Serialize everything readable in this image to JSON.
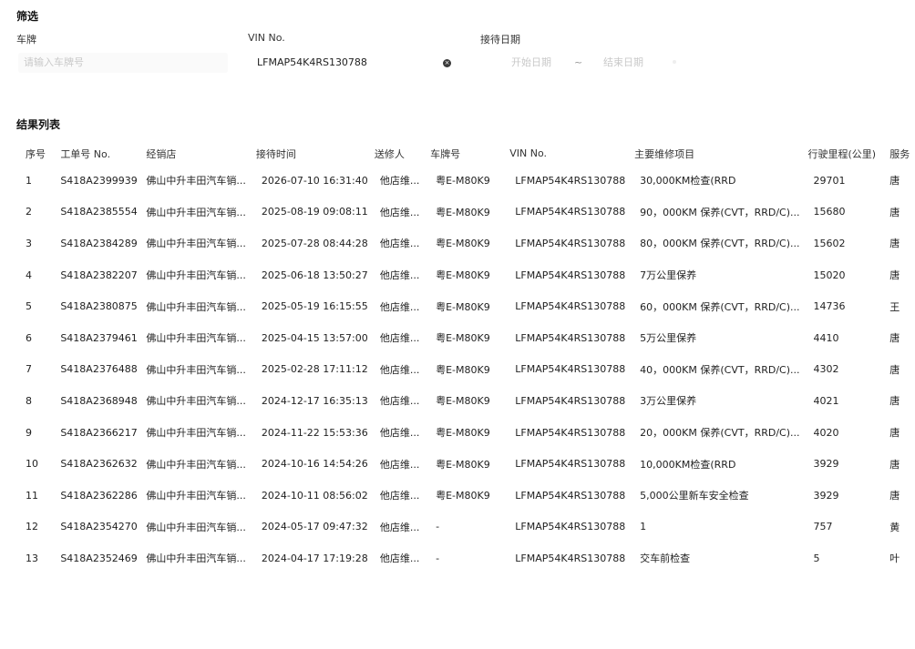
{
  "filter": {
    "title": "筛选",
    "plate_label": "车牌",
    "plate_placeholder": "请输入车牌号",
    "vin_label": "VIN No.",
    "vin_value": "LFMAP54K4RS130788",
    "date_label": "接待日期",
    "date_start_placeholder": "开始日期",
    "date_sep": "~",
    "date_end_placeholder": "结束日期"
  },
  "results": {
    "title": "结果列表",
    "columns": [
      "序号",
      "工单号 No.",
      "经销店",
      "接待时间",
      "送修人",
      "车牌号",
      "VIN No.",
      "主要维修项目",
      "行驶里程(公里)",
      "服务"
    ],
    "rows": [
      [
        "1",
        "S418A2399939",
        "佛山中升丰田汽车销...",
        "2026-07-10 16:31:40",
        "他店维...",
        "粤E-M80K9",
        "LFMAP54K4RS130788",
        "30,000KM检查(RRD",
        "29701",
        "唐"
      ],
      [
        "2",
        "S418A2385554",
        "佛山中升丰田汽车销...",
        "2025-08-19 09:08:11",
        "他店维...",
        "粤E-M80K9",
        "LFMAP54K4RS130788",
        "90，000KM 保养(CVT，RRD/C)...",
        "15680",
        "唐"
      ],
      [
        "3",
        "S418A2384289",
        "佛山中升丰田汽车销...",
        "2025-07-28 08:44:28",
        "他店维...",
        "粤E-M80K9",
        "LFMAP54K4RS130788",
        "80，000KM 保养(CVT，RRD/C)...",
        "15602",
        "唐"
      ],
      [
        "4",
        "S418A2382207",
        "佛山中升丰田汽车销...",
        "2025-06-18 13:50:27",
        "他店维...",
        "粤E-M80K9",
        "LFMAP54K4RS130788",
        "7万公里保养",
        "15020",
        "唐"
      ],
      [
        "5",
        "S418A2380875",
        "佛山中升丰田汽车销...",
        "2025-05-19 16:15:55",
        "他店维...",
        "粤E-M80K9",
        "LFMAP54K4RS130788",
        "60，000KM 保养(CVT，RRD/C)...",
        "14736",
        "王"
      ],
      [
        "6",
        "S418A2379461",
        "佛山中升丰田汽车销...",
        "2025-04-15 13:57:00",
        "他店维...",
        "粤E-M80K9",
        "LFMAP54K4RS130788",
        "5万公里保养",
        "4410",
        "唐"
      ],
      [
        "7",
        "S418A2376488",
        "佛山中升丰田汽车销...",
        "2025-02-28 17:11:12",
        "他店维...",
        "粤E-M80K9",
        "LFMAP54K4RS130788",
        "40，000KM 保养(CVT，RRD/C)...",
        "4302",
        "唐"
      ],
      [
        "8",
        "S418A2368948",
        "佛山中升丰田汽车销...",
        "2024-12-17 16:35:13",
        "他店维...",
        "粤E-M80K9",
        "LFMAP54K4RS130788",
        "3万公里保养",
        "4021",
        "唐"
      ],
      [
        "9",
        "S418A2366217",
        "佛山中升丰田汽车销...",
        "2024-11-22 15:53:36",
        "他店维...",
        "粤E-M80K9",
        "LFMAP54K4RS130788",
        "20，000KM 保养(CVT，RRD/C)...",
        "4020",
        "唐"
      ],
      [
        "10",
        "S418A2362632",
        "佛山中升丰田汽车销...",
        "2024-10-16 14:54:26",
        "他店维...",
        "粤E-M80K9",
        "LFMAP54K4RS130788",
        "10,000KM检查(RRD",
        "3929",
        "唐"
      ],
      [
        "11",
        "S418A2362286",
        "佛山中升丰田汽车销...",
        "2024-10-11 08:56:02",
        "他店维...",
        "粤E-M80K9",
        "LFMAP54K4RS130788",
        "5,000公里新车安全检查",
        "3929",
        "唐"
      ],
      [
        "12",
        "S418A2354270",
        "佛山中升丰田汽车销...",
        "2024-05-17 09:47:32",
        "他店维...",
        "-",
        "LFMAP54K4RS130788",
        "1",
        "757",
        "黄"
      ],
      [
        "13",
        "S418A2352469",
        "佛山中升丰田汽车销...",
        "2024-04-17 17:19:28",
        "他店维...",
        "-",
        "LFMAP54K4RS130788",
        "交车前检查",
        "5",
        "叶"
      ]
    ]
  },
  "icons": {
    "clear": "clear-circle-icon"
  },
  "colors": {
    "placeholder": "#c9c9c9",
    "text": "#222222",
    "clear_icon": "#3a3a3a"
  }
}
